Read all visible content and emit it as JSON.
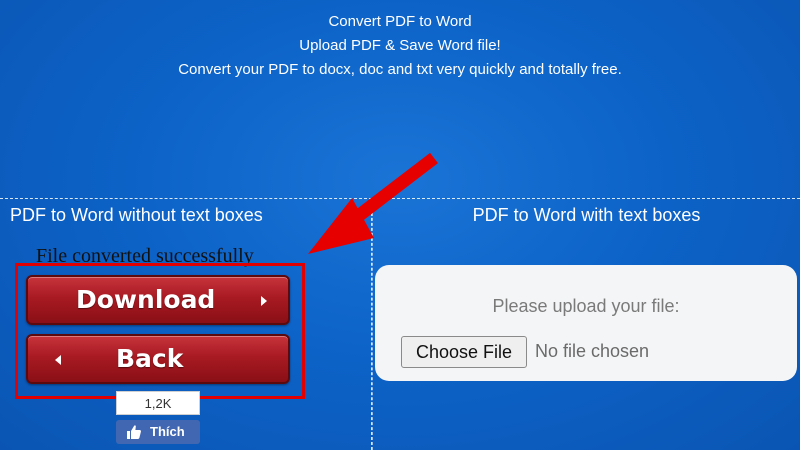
{
  "hero": {
    "line1": "Convert PDF to Word",
    "line2": "Upload PDF & Save Word file!",
    "line3": "Convert your PDF to docx, doc and txt very quickly and totally free."
  },
  "left_panel": {
    "title": "PDF to Word without text boxes",
    "status": "File converted successfully",
    "download_label": "Download",
    "back_label": "Back",
    "like_count": "1,2K",
    "like_label": "Thích"
  },
  "right_panel": {
    "title": "PDF to Word with text boxes",
    "upload_prompt": "Please upload your file:",
    "choose_file_label": "Choose File",
    "file_status": "No file chosen"
  },
  "colors": {
    "background": "#0d63c8",
    "button_red": "#a81a22",
    "highlight_red": "#e30000",
    "facebook_blue": "#4267b2"
  },
  "icons": {
    "download_arrow": "triangle-right",
    "back_arrow": "triangle-left",
    "like": "thumbs-up",
    "annotation": "red-arrow"
  }
}
